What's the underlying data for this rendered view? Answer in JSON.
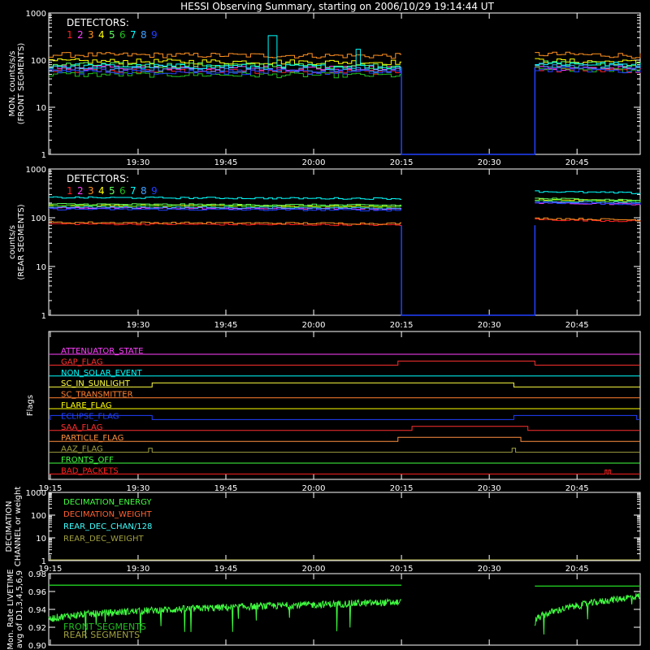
{
  "title": "HESSI Observing Summary, starting on 2006/10/29 19:14:44 UT",
  "time_ticks": [
    "19:15",
    "19:30",
    "19:45",
    "20:00",
    "20:15",
    "20:30",
    "20:45"
  ],
  "detector_colors": [
    "#ff2020",
    "#ff40ff",
    "#ff9020",
    "#ffff00",
    "#60ff60",
    "#20c020",
    "#00ffff",
    "#40a0ff",
    "#2040ff"
  ],
  "flag_colors": {
    "attenuator": "#ff40ff",
    "gap": "#ff3030",
    "nonsolar": "#00ffff",
    "sunlight": "#ffff40",
    "transmitter": "#ff8030",
    "flare": "#ffff00",
    "eclipse": "#2040ff",
    "saa": "#ff3030",
    "particle": "#ff9040",
    "aaz": "#a0a040",
    "fronts": "#40ff40",
    "bad": "#ff2020"
  },
  "chart_data": [
    {
      "type": "line",
      "name": "front-rates",
      "ylabel": "MON. counts/s/s (FRONT SEGMENTS)",
      "ylabel_lines": [
        "MON. counts/s/s",
        "(FRONT SEGMENTS)"
      ],
      "yscale": "log",
      "ylim": [
        1,
        1000
      ],
      "yticks": [
        1,
        10,
        100,
        1000
      ],
      "ytick_labels": [
        "1",
        "10",
        "100",
        "1000"
      ],
      "legend_title": "DETECTORS:",
      "legend_items": [
        "1",
        "2",
        "3",
        "4",
        "5",
        "6",
        "7",
        "8",
        "9"
      ],
      "x_hours": [
        19.25,
        20.25,
        20.63,
        20.92
      ],
      "gap_hours": [
        20.25,
        20.63
      ],
      "series": [
        {
          "label": "1",
          "values": [
            60,
            60
          ]
        },
        {
          "label": "2",
          "values": [
            70,
            65
          ]
        },
        {
          "label": "3",
          "values": [
            130,
            125
          ]
        },
        {
          "label": "4",
          "values": [
            95,
            90
          ]
        },
        {
          "label": "5",
          "values": [
            80,
            80
          ]
        },
        {
          "label": "6",
          "values": [
            50,
            60
          ]
        },
        {
          "label": "7",
          "values": [
            75,
            80
          ]
        },
        {
          "label": "8",
          "values": [
            65,
            70
          ]
        },
        {
          "label": "9",
          "values": [
            58,
            60
          ]
        }
      ]
    },
    {
      "type": "line",
      "name": "rear-rates",
      "ylabel": "counts/s (REAR SEGMENTS)",
      "ylabel_lines": [
        "counts/s",
        "(REAR SEGMENTS)"
      ],
      "yscale": "log",
      "ylim": [
        1,
        1000
      ],
      "yticks": [
        1,
        10,
        100,
        1000
      ],
      "ytick_labels": [
        "1",
        "10",
        "100",
        "1000"
      ],
      "legend_title": "DETECTORS:",
      "legend_items": [
        "1",
        "2",
        "3",
        "4",
        "5",
        "6",
        "7",
        "8",
        "9"
      ],
      "series": [
        {
          "label": "1",
          "values": [
            75,
            85
          ]
        },
        {
          "label": "2",
          "values": [
            160,
            190
          ]
        },
        {
          "label": "3",
          "values": [
            80,
            90
          ]
        },
        {
          "label": "4",
          "values": [
            180,
            220
          ]
        },
        {
          "label": "5",
          "values": [
            190,
            230
          ]
        },
        {
          "label": "6",
          "values": [
            175,
            210
          ]
        },
        {
          "label": "7",
          "values": [
            260,
            320
          ]
        },
        {
          "label": "8",
          "values": [
            165,
            200
          ]
        },
        {
          "label": "9",
          "values": [
            150,
            190
          ]
        }
      ]
    },
    {
      "type": "line",
      "name": "flags",
      "ylabel": "Flags",
      "flags": [
        {
          "key": "attenuator",
          "label": "ATTENUATOR_STATE",
          "on": []
        },
        {
          "key": "gap",
          "label": "GAP_FLAG",
          "on": [
            [
              20.24,
              20.63
            ]
          ]
        },
        {
          "key": "nonsolar",
          "label": "NON_SOLAR_EVENT",
          "on": []
        },
        {
          "key": "sunlight",
          "label": "SC_IN_SUNLIGHT",
          "on": [
            [
              19.54,
              20.57
            ]
          ]
        },
        {
          "key": "transmitter",
          "label": "SC_TRANSMITTER",
          "on": []
        },
        {
          "key": "flare",
          "label": "FLARE_FLAG",
          "on": []
        },
        {
          "key": "eclipse",
          "label": "ECLIPSE_FLAG",
          "on": [
            [
              19.25,
              19.54
            ],
            [
              20.57,
              20.92
            ]
          ]
        },
        {
          "key": "saa",
          "label": "SAA_FLAG",
          "on": [
            [
              20.28,
              20.61
            ]
          ]
        },
        {
          "key": "particle",
          "label": "PARTICLE_FLAG",
          "on": [
            [
              20.24,
              20.59
            ]
          ]
        },
        {
          "key": "aaz",
          "label": "AAZ_FLAG",
          "on": [
            [
              19.53,
              19.54
            ],
            [
              20.565,
              20.575
            ]
          ]
        },
        {
          "key": "fronts",
          "label": "FRONTS_OFF",
          "on": []
        },
        {
          "key": "bad",
          "label": "BAD_PACKETS",
          "on": [
            [
              20.83,
              20.835
            ],
            [
              20.84,
              20.845
            ]
          ]
        }
      ]
    },
    {
      "type": "line",
      "name": "decimation",
      "ylabel": "DECIMATION CHANNEL or weight",
      "ylabel_lines": [
        "DECIMATION",
        "CHANNEL or weight"
      ],
      "yscale": "log",
      "ylim": [
        1,
        1000
      ],
      "yticks": [
        1,
        10,
        100,
        1000
      ],
      "ytick_labels": [
        "1",
        "10",
        "100",
        "1000"
      ],
      "legend": [
        {
          "label": "DECIMATION_ENERGY",
          "color": "#40ff40"
        },
        {
          "label": "DECIMATION_WEIGHT",
          "color": "#ff6030"
        },
        {
          "label": "REAR_DEC_CHAN/128",
          "color": "#40ffff"
        },
        {
          "label": "REAR_DEC_WEIGHT",
          "color": "#a0a040"
        }
      ]
    },
    {
      "type": "line",
      "name": "livetime",
      "ylabel": "Mon. Rate LIVETIME avg of D1,3,4,5,6,9",
      "ylabel_lines": [
        "Mon. Rate LIVETIME",
        "avg of D1,3,4,5,6,9"
      ],
      "ylim": [
        0.9,
        0.98
      ],
      "yticks": [
        0.9,
        0.92,
        0.94,
        0.96,
        0.98
      ],
      "ytick_labels": [
        "0.90",
        "0.92",
        "0.94",
        "0.96",
        "0.98"
      ],
      "legend": [
        {
          "label": "FRONT SEGMENTS",
          "color": "#20c020"
        },
        {
          "label": "REAR SEGMENTS",
          "color": "#a0a040"
        }
      ],
      "series": [
        {
          "label": "FRONT SEGMENTS",
          "values": [
            0.935,
            0.955
          ]
        },
        {
          "label": "REAR SEGMENTS",
          "values": [
            0.967,
            0.966
          ]
        }
      ]
    }
  ]
}
